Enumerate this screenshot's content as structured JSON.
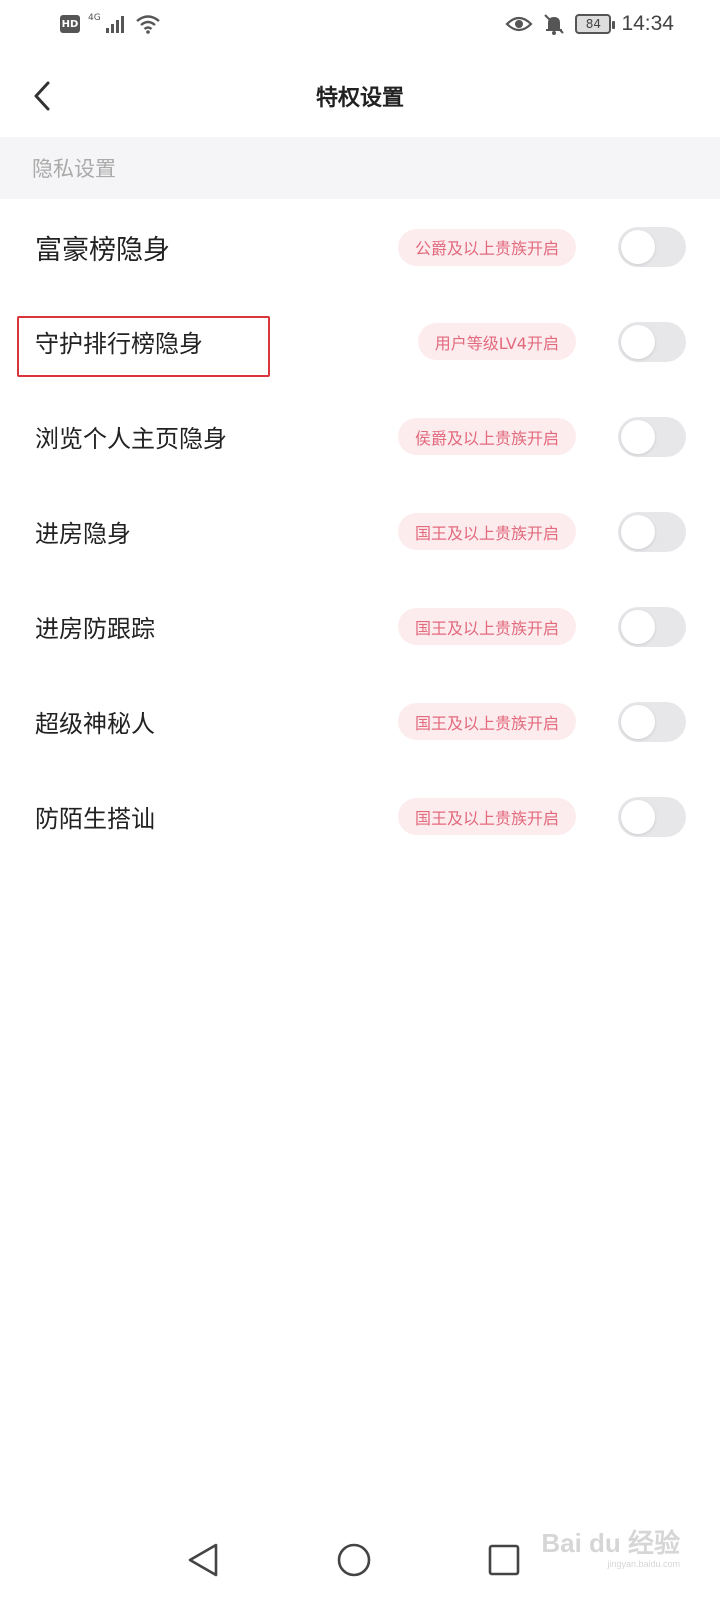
{
  "status_bar": {
    "hd": "HD",
    "network": "4G",
    "battery": "84",
    "time": "14:34",
    "icons": [
      "signal-icon",
      "wifi-icon",
      "eye-icon",
      "bell-off-icon",
      "battery-icon"
    ]
  },
  "header": {
    "title": "特权设置",
    "back_icon": "chevron-left-icon"
  },
  "section": {
    "title": "隐私设置"
  },
  "settings": [
    {
      "label": "富豪榜隐身",
      "requirement": "公爵及以上贵族开启",
      "enabled": false
    },
    {
      "label": "守护排行榜隐身",
      "requirement": "用户等级LV4开启",
      "enabled": false
    },
    {
      "label": "浏览个人主页隐身",
      "requirement": "侯爵及以上贵族开启",
      "enabled": false
    },
    {
      "label": "进房隐身",
      "requirement": "国王及以上贵族开启",
      "enabled": false
    },
    {
      "label": "进房防跟踪",
      "requirement": "国王及以上贵族开启",
      "enabled": false
    },
    {
      "label": "超级神秘人",
      "requirement": "国王及以上贵族开启",
      "enabled": false
    },
    {
      "label": "防陌生搭讪",
      "requirement": "国王及以上贵族开启",
      "enabled": false
    }
  ],
  "colors": {
    "badge_bg": "#fdecee",
    "badge_text": "#e26a7d",
    "toggle_off": "#e7e7ea",
    "highlight": "#d9353a"
  },
  "watermark": {
    "text": "Bai du 经验",
    "url": "jingyan.baidu.com"
  }
}
